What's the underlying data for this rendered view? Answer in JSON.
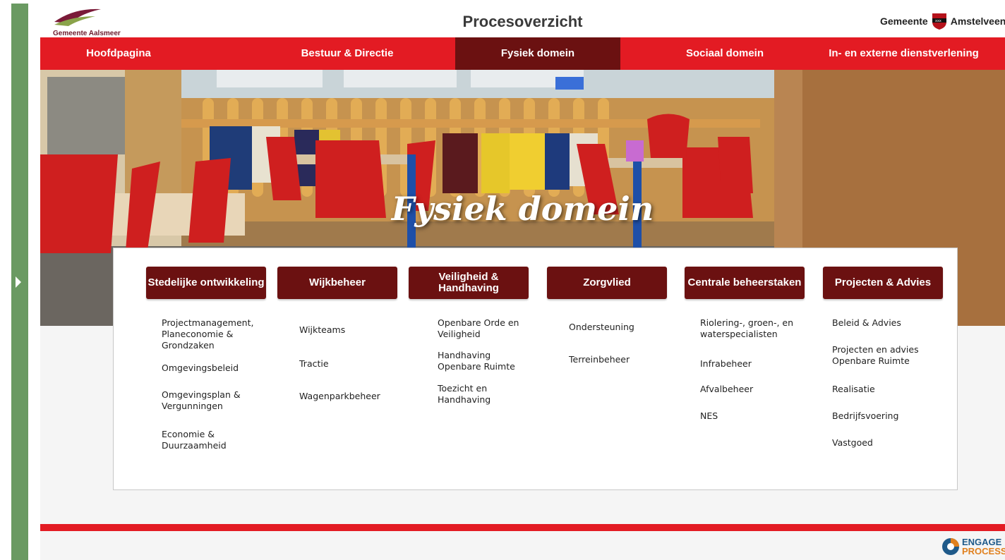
{
  "header": {
    "left_logo_text": "Gemeente Aalsmeer",
    "title": "Procesoverzicht",
    "right_logo_prefix": "Gemeente",
    "right_logo_name": "Amstelveen"
  },
  "nav": {
    "items": [
      {
        "label": "Hoofdpagina"
      },
      {
        "label": "Bestuur & Directie"
      },
      {
        "label": "Fysiek domein",
        "active": true
      },
      {
        "label": "Sociaal domein"
      },
      {
        "label": "In- en externe dienstverlening"
      }
    ]
  },
  "hero": {
    "title": "Fysiek domein"
  },
  "columns": [
    {
      "title": "Stedelijke ontwikkeling",
      "items": [
        "Projectmanagement, Planeconomie & Grondzaken",
        "Omgevingsbeleid",
        "Omgevingsplan & Vergunningen",
        "Economie & Duurzaamheid"
      ]
    },
    {
      "title": "Wijkbeheer",
      "items": [
        "Wijkteams",
        "Tractie",
        "Wagenparkbeheer"
      ]
    },
    {
      "title": "Veiligheid & Handhaving",
      "items": [
        "Openbare Orde en Veiligheid",
        "Handhaving Openbare Ruimte",
        "Toezicht en Handhaving"
      ]
    },
    {
      "title": "Zorgvlied",
      "items": [
        "Ondersteuning",
        "Terreinbeheer"
      ]
    },
    {
      "title": "Centrale beheerstaken",
      "items": [
        "Riolering-, groen-, en waterspecialisten",
        "Infrabeheer",
        "Afvalbeheer",
        "NES"
      ]
    },
    {
      "title": "Projecten & Advies",
      "items": [
        "Beleid & Advies",
        "Projecten en advies Openbare Ruimte",
        "Realisatie",
        "Bedrijfsvoering",
        "Vastgoed"
      ]
    }
  ],
  "footer": {
    "brand_top": "ENGAGE",
    "brand_bottom": "PROCESS"
  },
  "colors": {
    "nav_red": "#e31b23",
    "dark_red": "#6b1111",
    "side_green": "#6a9a62"
  }
}
